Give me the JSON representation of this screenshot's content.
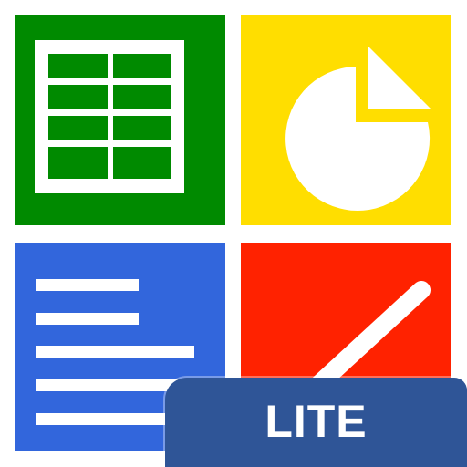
{
  "badge": {
    "label": "LITE"
  },
  "tiles": [
    {
      "name": "spreadsheet",
      "icon": "spreadsheet-grid-icon",
      "color": "#008a00"
    },
    {
      "name": "presentation",
      "icon": "pie-chart-icon",
      "color": "#ffde00"
    },
    {
      "name": "document",
      "icon": "text-lines-icon",
      "color": "#3266dc"
    },
    {
      "name": "drawing",
      "icon": "pencil-line-icon",
      "color": "#ff2200"
    }
  ],
  "colors": {
    "badge": "#2f5597",
    "foreground": "#ffffff"
  }
}
